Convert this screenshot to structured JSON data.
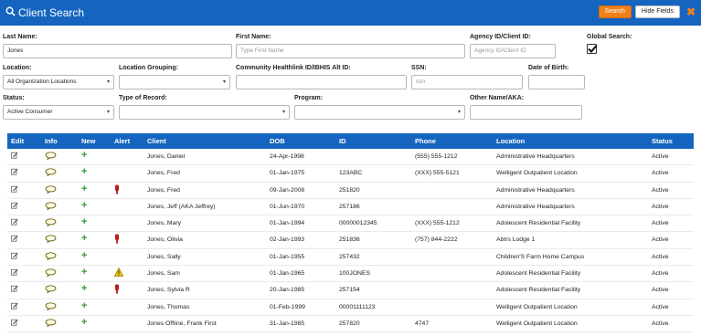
{
  "header": {
    "title": "Client Search",
    "search_label": "Search",
    "hide_fields_label": "Hide Fields",
    "close_glyph": "✖"
  },
  "form": {
    "last_name": {
      "label": "Last Name:",
      "value": "Jones"
    },
    "first_name": {
      "label": "First Name:",
      "placeholder": "Type First Name"
    },
    "agency_id": {
      "label": "Agency ID/Client ID:",
      "placeholder": "Agency ID/Client ID"
    },
    "global_search": {
      "label": "Global Search:",
      "checked": true
    },
    "location": {
      "label": "Location:",
      "value": "All Organization Locations"
    },
    "location_grouping": {
      "label": "Location Grouping:",
      "value": ""
    },
    "community_id": {
      "label": "Community Healthlink ID/IBHIS Alt ID:",
      "value": ""
    },
    "ssn": {
      "label": "SSN:",
      "placeholder": "ssn"
    },
    "dob": {
      "label": "Date of Birth:",
      "value": ""
    },
    "status": {
      "label": "Status:",
      "value": "Active Consumer"
    },
    "type_of_record": {
      "label": "Type of Record:",
      "value": ""
    },
    "program": {
      "label": "Program:",
      "value": ""
    },
    "other_name": {
      "label": "Other Name/AKA:",
      "value": ""
    }
  },
  "table": {
    "columns": [
      "Edit",
      "Info",
      "New",
      "Alert",
      "Client",
      "DOB",
      "ID",
      "Phone",
      "Location",
      "Status"
    ],
    "rows": [
      {
        "client": "Jones, Daniel",
        "dob": "24-Apr-1998",
        "id": "",
        "phone": "(555) 555-1212",
        "location": "Administrative Headquarters",
        "status": "Active",
        "alert": ""
      },
      {
        "client": "Jones, Fred",
        "dob": "01-Jan-1975",
        "id": "123ABC",
        "phone": "(XXX) 555-5121",
        "location": "Welligent Outpatient Location",
        "status": "Active",
        "alert": ""
      },
      {
        "client": "Jones, Fred",
        "dob": "09-Jan-2008",
        "id": "251820",
        "phone": "",
        "location": "Administrative Headquarters",
        "status": "Active",
        "alert": "exclamation"
      },
      {
        "client": "Jones, Jeff (AKA Jeffrey)",
        "dob": "01-Jun-1970",
        "id": "257186",
        "phone": "",
        "location": "Administrative Headquarters",
        "status": "Active",
        "alert": ""
      },
      {
        "client": "Jones, Mary",
        "dob": "01-Jan-1994",
        "id": "00000012345",
        "phone": "(XXX) 555-1212",
        "location": "Adolescent Residential Facility",
        "status": "Active",
        "alert": ""
      },
      {
        "client": "Jones, Olivia",
        "dob": "02-Jan-1993",
        "id": "251836",
        "phone": "(757) 844-2222",
        "location": "Abtrs Lodge 1",
        "status": "Active",
        "alert": "exclamation"
      },
      {
        "client": "Jones, Sally",
        "dob": "01-Jan-1955",
        "id": "257432",
        "phone": "",
        "location": "Children'S Farm Home Campus",
        "status": "Active",
        "alert": ""
      },
      {
        "client": "Jones, Sam",
        "dob": "01-Jan-1965",
        "id": "100JONES",
        "phone": "",
        "location": "Adolescent Residential Facility",
        "status": "Active",
        "alert": "warning"
      },
      {
        "client": "Jones, Sylvia R",
        "dob": "20-Jan-1985",
        "id": "257154",
        "phone": "",
        "location": "Adolescent Residential Facility",
        "status": "Active",
        "alert": "exclamation"
      },
      {
        "client": "Jones, Thomas",
        "dob": "01-Feb-1999",
        "id": "00001111123",
        "phone": "",
        "location": "Welligent Outpatient Location",
        "status": "Active",
        "alert": ""
      },
      {
        "client": "Jones Offline, Frank First",
        "dob": "31-Jan-1985",
        "id": "257820",
        "phone": "4747",
        "location": "Welligent Outpatient Location",
        "status": "Active",
        "alert": ""
      }
    ]
  },
  "colors": {
    "header_bg": "#1565c0",
    "accent": "#f0801a",
    "new_icon": "#2e9b2e",
    "alert_red": "#b71c1c",
    "warning_yellow": "#f2c200"
  }
}
